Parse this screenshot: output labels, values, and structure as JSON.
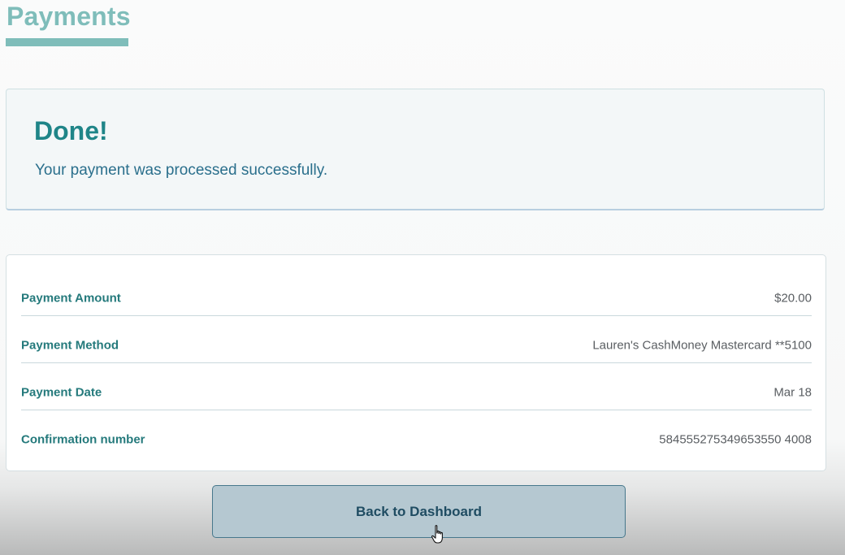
{
  "header": {
    "title": "Payments"
  },
  "success": {
    "heading": "Done!",
    "message": "Your payment was processed successfully."
  },
  "details": {
    "rows": [
      {
        "label": "Payment Amount",
        "value": "$20.00"
      },
      {
        "label": "Payment Method",
        "value": "Lauren's CashMoney Mastercard **5100"
      },
      {
        "label": "Payment Date",
        "value": "Mar 18"
      },
      {
        "label": "Confirmation number",
        "value": "584555275349653550 4008"
      }
    ]
  },
  "actions": {
    "back_label": "Back to Dashboard"
  },
  "colors": {
    "accent": "#7fbdba",
    "heading": "#1f8588",
    "label": "#257a7c",
    "button_bg": "#b5c8d1",
    "button_border": "#47788c"
  },
  "icons": {
    "cursor": "hand-pointer-icon"
  }
}
